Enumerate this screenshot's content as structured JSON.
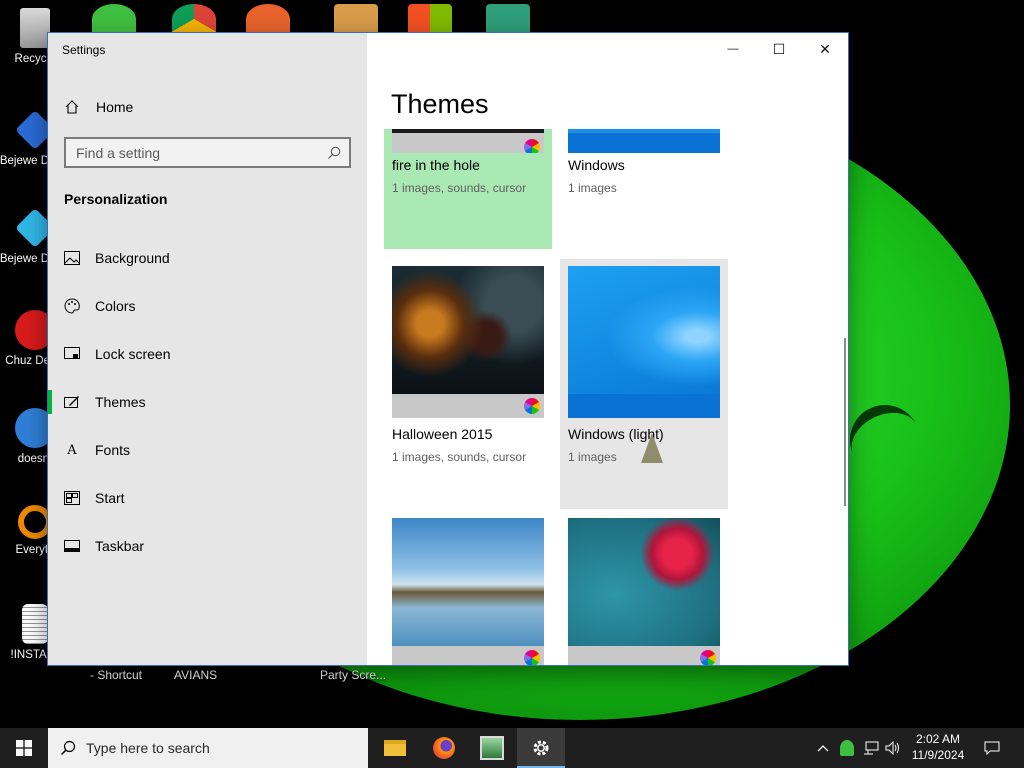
{
  "desktop": {
    "icons": [
      {
        "label": "Recycle"
      },
      {
        "label": "Bejewe Delux"
      },
      {
        "label": "Bejewe Delux"
      },
      {
        "label": "Chuz Delux"
      },
      {
        "label": "doesnt"
      },
      {
        "label": "Everyth"
      },
      {
        "label": "!INSTALL"
      }
    ],
    "bottom_labels": [
      "- Shortcut",
      "AVIANS",
      "Party Scre..."
    ]
  },
  "window": {
    "title": "Settings",
    "controls": {
      "minimize": "—",
      "maximize": "☐",
      "close": "✕"
    }
  },
  "sidebar": {
    "home_label": "Home",
    "search_placeholder": "Find a setting",
    "section_heading": "Personalization",
    "items": [
      {
        "label": "Background",
        "icon": "picture-icon"
      },
      {
        "label": "Colors",
        "icon": "palette-icon"
      },
      {
        "label": "Lock screen",
        "icon": "lock-screen-icon"
      },
      {
        "label": "Themes",
        "icon": "themes-icon",
        "active": true
      },
      {
        "label": "Fonts",
        "icon": "fonts-icon"
      },
      {
        "label": "Start",
        "icon": "start-icon"
      },
      {
        "label": "Taskbar",
        "icon": "taskbar-icon"
      }
    ]
  },
  "main": {
    "title": "Themes",
    "themes": [
      {
        "name": "fire in the hole",
        "desc": "1 images, sounds, cursor",
        "selected": true,
        "has_wheel": true
      },
      {
        "name": "Windows",
        "desc": "1 images",
        "has_wheel": false
      },
      {
        "name": "Halloween 2015",
        "desc": "1 images, sounds, cursor",
        "has_wheel": true
      },
      {
        "name": "Windows (light)",
        "desc": "1 images",
        "hovered": true,
        "has_wheel": false
      },
      {
        "name": "",
        "desc": "",
        "has_wheel": true
      },
      {
        "name": "",
        "desc": "",
        "has_wheel": true
      }
    ]
  },
  "taskbar": {
    "search_placeholder": "Type here to search",
    "apps": [
      "file-explorer-icon",
      "firefox-icon",
      "game-icon",
      "settings-icon"
    ],
    "clock": {
      "time": "2:02 AM",
      "date": "11/9/2024"
    }
  },
  "colors": {
    "accent": "#00b33c",
    "selected_tile": "#abe9b4",
    "sidebar_bg": "#e6e6e6",
    "taskbar_bg": "#1f1f1f",
    "desktop_blob": "#19c219"
  }
}
